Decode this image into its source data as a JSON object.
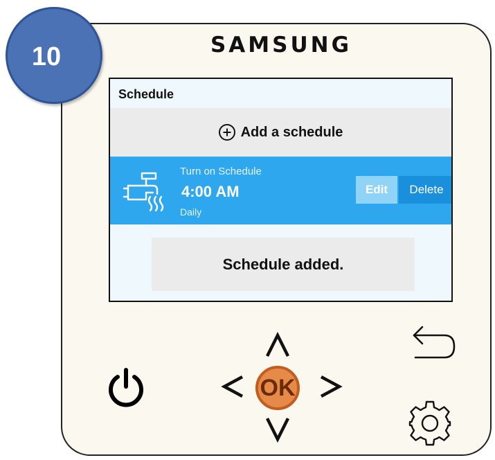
{
  "step_number": "10",
  "brand": "SAMSUNG",
  "screen": {
    "title": "Schedule",
    "add_label": "Add a schedule",
    "schedule": {
      "subtitle": "Turn on Schedule",
      "time": "4:00 AM",
      "repeat": "Daily",
      "edit_label": "Edit",
      "delete_label": "Delete"
    },
    "toast": "Schedule added."
  },
  "controls": {
    "ok_label": "OK",
    "highlight_color": "#e07b39",
    "icons": [
      "back-arrow-icon",
      "power-icon",
      "up-arrow-icon",
      "left-arrow-icon",
      "right-arrow-icon",
      "down-arrow-icon",
      "gear-icon"
    ]
  },
  "colors": {
    "badge": "#4a72b4",
    "schedule_row": "#2ea7ee",
    "edit_button": "#8fd3f7",
    "delete_button": "#1a8fdc",
    "device_body": "#fbf8ef"
  }
}
